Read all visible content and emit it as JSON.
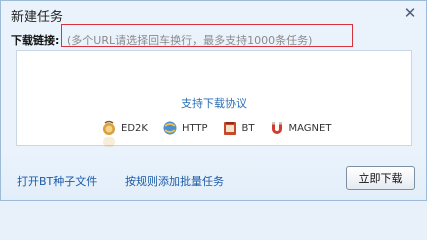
{
  "window": {
    "title": "新建任务",
    "close_symbol": "✕"
  },
  "download": {
    "label": "下载链接:",
    "hint": "(多个URL请选择回车换行，最多支持1000条任务)"
  },
  "protocols": {
    "title": "支持下载协议",
    "items": [
      {
        "label": "ED2K",
        "icon": "ed2k-icon"
      },
      {
        "label": "HTTP",
        "icon": "http-icon"
      },
      {
        "label": "BT",
        "icon": "bt-icon"
      },
      {
        "label": "MAGNET",
        "icon": "magnet-icon"
      }
    ]
  },
  "footer": {
    "open_bt": "打开BT种子文件",
    "batch_add": "按规则添加批量任务",
    "download_now": "立即下载"
  },
  "colors": {
    "link": "#1c5aa8",
    "highlight_box": "#d6333f"
  }
}
